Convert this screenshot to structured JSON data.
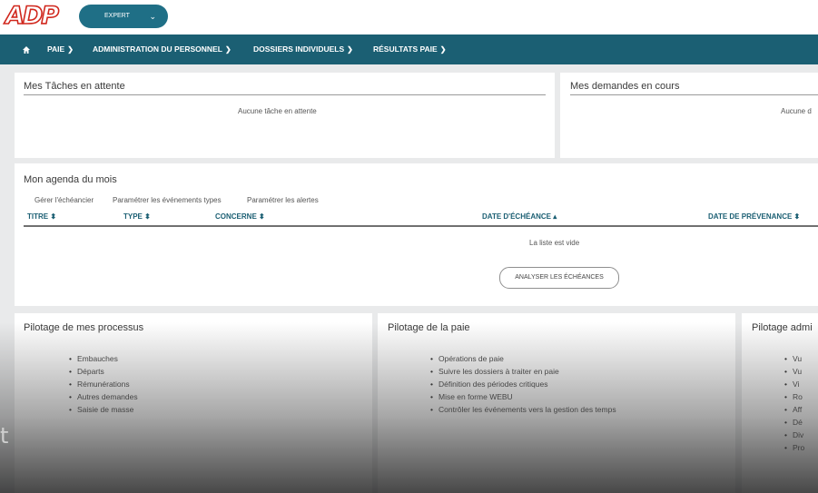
{
  "brand": {
    "logo_text": "ADP",
    "accent": "#d0271d",
    "nav_color": "#1b5f73"
  },
  "role_select": {
    "value": "EXPERT",
    "icon": "chevron-down-icon"
  },
  "nav": {
    "home_icon": "home-icon",
    "items": [
      {
        "label": "PAIE",
        "icon": "chevron-down-icon"
      },
      {
        "label": "ADMINISTRATION DU PERSONNEL",
        "icon": "chevron-down-icon"
      },
      {
        "label": "DOSSIERS INDIVIDUELS",
        "icon": "chevron-down-icon"
      },
      {
        "label": "RÉSULTATS PAIE",
        "icon": "chevron-down-icon"
      }
    ]
  },
  "tasks": {
    "title": "Mes Tâches en attente",
    "empty": "Aucune tâche en attente"
  },
  "requests": {
    "title": "Mes demandes en cours",
    "empty": "Aucune d"
  },
  "agenda": {
    "title": "Mon agenda du mois",
    "links": [
      "Gérer l'échéancier",
      "Paramétrer les événements types",
      "Paramétrer les alertes"
    ],
    "columns": [
      "TITRE",
      "TYPE",
      "CONCERNE",
      "DATE D'ÉCHÉANCE",
      "DATE DE PRÉVENANCE"
    ],
    "empty": "La liste est vide",
    "button": "ANALYSER LES ÉCHÉANCES"
  },
  "processes": {
    "title": "Pilotage de mes processus",
    "items": [
      "Embauches",
      "Départs",
      "Rémunérations",
      "Autres demandes",
      "Saisie de masse"
    ]
  },
  "payroll": {
    "title": "Pilotage de la paie",
    "items": [
      "Opérations de paie",
      "Suivre les dossiers à traiter en paie",
      "Définition des périodes critiques",
      "Mise en forme WEBU",
      "Contrôler les événements vers la gestion des temps"
    ]
  },
  "admin": {
    "title": "Pilotage admi",
    "items": [
      "Vu",
      "Vu",
      "Vi",
      "Ro",
      "Aff",
      "Dé",
      "Div",
      "Pro"
    ]
  },
  "overlay_text": "t"
}
